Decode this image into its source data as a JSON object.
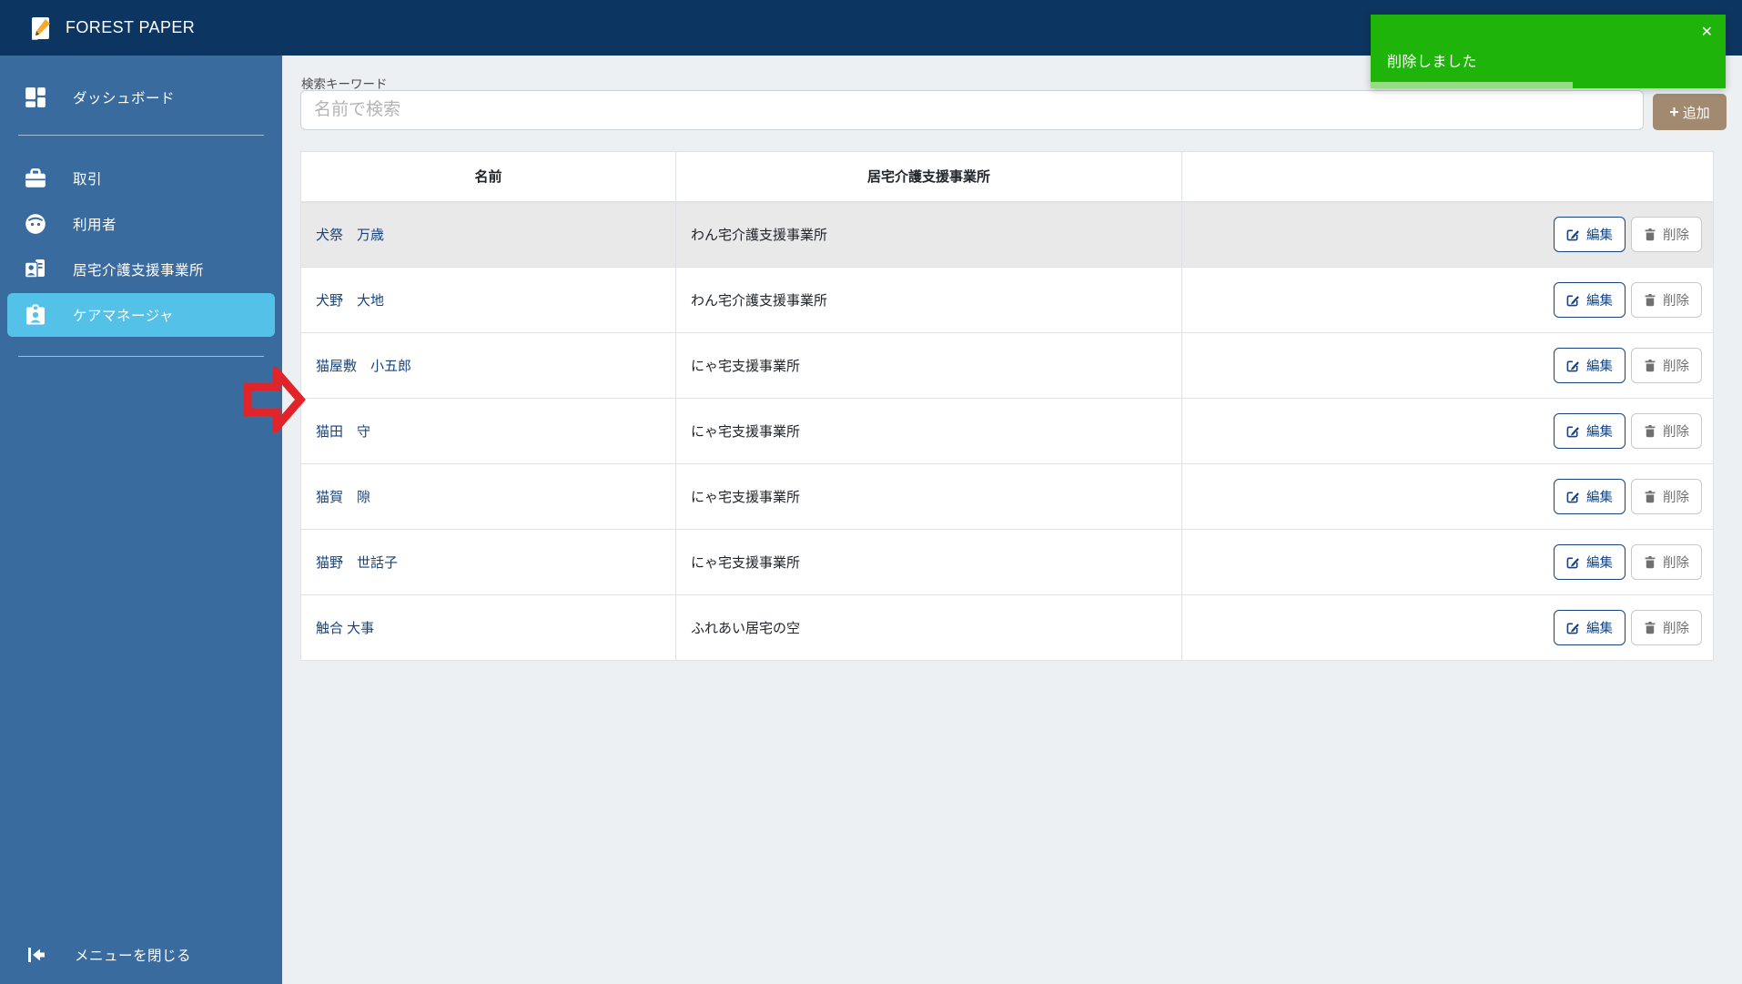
{
  "topbar": {
    "title": "FOREST PAPER"
  },
  "toast": {
    "message": "削除しました",
    "close_icon": "✕",
    "progress_percent": 57
  },
  "sidebar": {
    "items": [
      {
        "label": "ダッシュボード",
        "icon": "dashboard-icon",
        "active": false
      },
      {
        "label": "取引",
        "icon": "briefcase-icon",
        "active": false
      },
      {
        "label": "利用者",
        "icon": "user-face-icon",
        "active": false
      },
      {
        "label": "居宅介護支援事業所",
        "icon": "office-contacts-icon",
        "active": false
      },
      {
        "label": "ケアマネージャ",
        "icon": "care-manager-badge-icon",
        "active": true
      }
    ],
    "footer": {
      "label": "メニューを閉じる",
      "icon": "collapse-menu-icon"
    }
  },
  "search": {
    "label": "検索キーワード",
    "placeholder": "名前で検索"
  },
  "add_button": {
    "label": "追加",
    "plus_icon": "+"
  },
  "table": {
    "headers": {
      "name": "名前",
      "office": "居宅介護支援事業所",
      "actions": ""
    },
    "actions": {
      "edit": "編集",
      "delete": "削除"
    },
    "rows": [
      {
        "name": "犬祭　万歳",
        "office": "わん宅介護支援事業所",
        "highlighted": true
      },
      {
        "name": "犬野　大地",
        "office": "わん宅介護支援事業所",
        "highlighted": false
      },
      {
        "name": "猫屋敷　小五郎",
        "office": "にゃ宅支援事業所",
        "highlighted": false
      },
      {
        "name": "猫田　守",
        "office": "にゃ宅支援事業所",
        "highlighted": false
      },
      {
        "name": "猫賀　隙",
        "office": "にゃ宅支援事業所",
        "highlighted": false
      },
      {
        "name": "猫野　世話子",
        "office": "にゃ宅支援事業所",
        "highlighted": false
      },
      {
        "name": "触合 大事",
        "office": "ふれあい居宅の空",
        "highlighted": false
      }
    ]
  },
  "colors": {
    "topbar_bg": "#0d3561",
    "sidebar_bg": "#3a6b9e",
    "active_bg": "#54c2e8",
    "content_bg": "#edf0f3",
    "toast_green": "#1eb40a",
    "toast_progress": "#96dc82",
    "add_brown": "#a28a71",
    "link_blue": "#16437e",
    "arrow_red": "#e1242a"
  }
}
